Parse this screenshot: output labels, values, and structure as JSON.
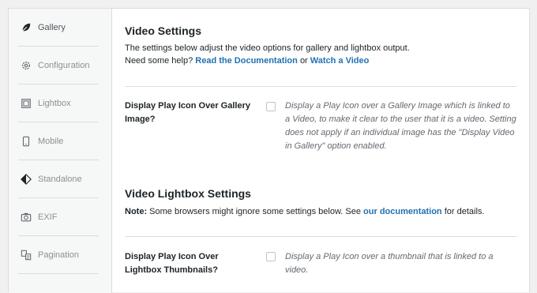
{
  "sidebar": {
    "items": [
      {
        "label": "Gallery",
        "icon": "leaf-icon",
        "active": true
      },
      {
        "label": "Configuration",
        "icon": "gear-icon"
      },
      {
        "label": "Lightbox",
        "icon": "lightbox-icon"
      },
      {
        "label": "Mobile",
        "icon": "mobile-icon"
      },
      {
        "label": "Standalone",
        "icon": "standalone-icon"
      },
      {
        "label": "EXIF",
        "icon": "camera-icon"
      },
      {
        "label": "Pagination",
        "icon": "pagination-icon"
      }
    ]
  },
  "video_settings": {
    "title": "Video Settings",
    "intro": "The settings below adjust the video options for gallery and lightbox output.",
    "help_prefix": "Need some help?",
    "docs_link": "Read the Documentation",
    "or": "or",
    "video_link": "Watch a Video"
  },
  "play_icon_gallery": {
    "label": "Display Play Icon Over Gallery Image?",
    "checked": false,
    "description": "Display a Play Icon over a Gallery Image which is linked to a Video, to make it clear to the user that it is a video. Setting does not apply if an individual image has the \"Display Video in Gallery\" option enabled."
  },
  "lightbox_settings": {
    "title": "Video Lightbox Settings",
    "note_label": "Note:",
    "note_text": "Some browsers might ignore some settings below. See",
    "note_link": "our documentation",
    "note_suffix": "for details."
  },
  "play_icon_thumbnails": {
    "label": "Display Play Icon Over Lightbox Thumbnails?",
    "checked": false,
    "description": "Display a Play Icon over a thumbnail that is linked to a video."
  }
}
